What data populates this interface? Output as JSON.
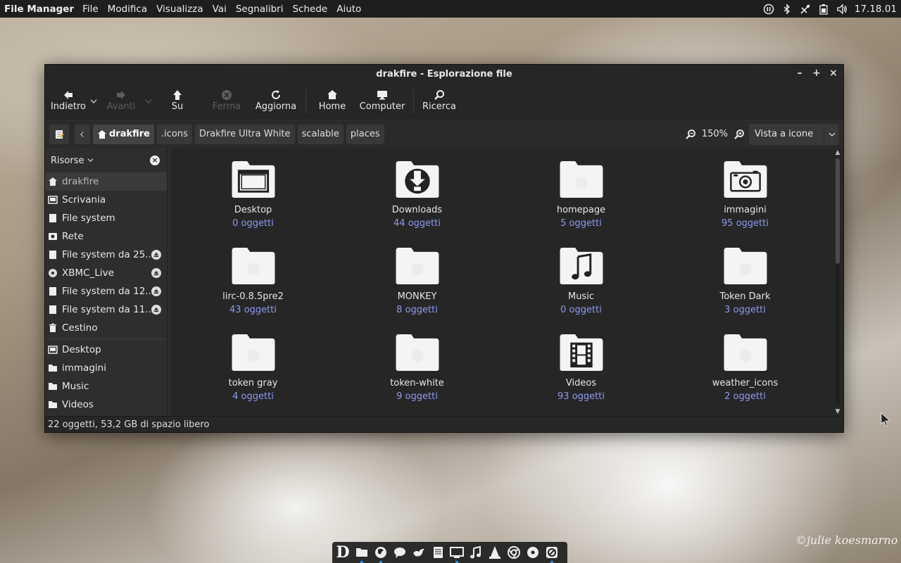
{
  "top_panel": {
    "app_name": "File Manager",
    "menus": [
      "File",
      "Modifica",
      "Visualizza",
      "Vai",
      "Segnalibri",
      "Schede",
      "Aiuto"
    ],
    "clock": "17.18.01"
  },
  "window": {
    "title": "drakfire - Esplorazione file",
    "controls": {
      "minimize": "–",
      "maximize": "+",
      "close": "×"
    }
  },
  "toolbar": {
    "back": "Indietro",
    "forward": "Avanti",
    "up": "Su",
    "stop": "Ferma",
    "reload": "Aggiorna",
    "home": "Home",
    "computer": "Computer",
    "search": "Ricerca"
  },
  "pathbar": {
    "crumbs": [
      "drakfire",
      ".icons",
      "Drakfire Ultra White",
      "scalable",
      "places"
    ],
    "zoom_level": "150%",
    "view_mode": "Vista a icone"
  },
  "sidebar": {
    "header": "Risorse",
    "places": [
      {
        "label": "drakfire",
        "icon": "home-icon"
      },
      {
        "label": "Scrivania",
        "icon": "desktop-icon"
      },
      {
        "label": "File system",
        "icon": "drive-icon"
      },
      {
        "label": "Rete",
        "icon": "network-icon"
      },
      {
        "label": "File system da 25...",
        "icon": "drive-icon",
        "eject": true
      },
      {
        "label": "XBMC_Live",
        "icon": "disc-icon",
        "eject": true
      },
      {
        "label": "File system da 12...",
        "icon": "drive-icon",
        "eject": true
      },
      {
        "label": "File system da 11...",
        "icon": "drive-icon",
        "eject": true
      },
      {
        "label": "Cestino",
        "icon": "trash-icon"
      }
    ],
    "bookmarks": [
      {
        "label": "Desktop",
        "icon": "desktop-icon"
      },
      {
        "label": "immagini",
        "icon": "folder-icon"
      },
      {
        "label": "Music",
        "icon": "folder-icon"
      },
      {
        "label": "Videos",
        "icon": "folder-icon"
      }
    ]
  },
  "files": [
    {
      "name": "Desktop",
      "count": "0 oggetti",
      "icon": "desktop-folder-icon"
    },
    {
      "name": "Downloads",
      "count": "44 oggetti",
      "icon": "downloads-folder-icon"
    },
    {
      "name": "homepage",
      "count": "5 oggetti",
      "icon": "folder-icon"
    },
    {
      "name": "immagini",
      "count": "95 oggetti",
      "icon": "camera-folder-icon"
    },
    {
      "name": "lirc-0.8.5pre2",
      "count": "43 oggetti",
      "icon": "folder-icon"
    },
    {
      "name": "MONKEY",
      "count": "8 oggetti",
      "icon": "folder-icon"
    },
    {
      "name": "Music",
      "count": "0 oggetti",
      "icon": "music-folder-icon"
    },
    {
      "name": "Token Dark",
      "count": "3 oggetti",
      "icon": "folder-icon"
    },
    {
      "name": "token gray",
      "count": "4 oggetti",
      "icon": "folder-icon"
    },
    {
      "name": "token-white",
      "count": "9 oggetti",
      "icon": "folder-icon"
    },
    {
      "name": "Videos",
      "count": "93 oggetti",
      "icon": "video-folder-icon"
    },
    {
      "name": "weather_icons",
      "count": "2 oggetti",
      "icon": "folder-icon"
    }
  ],
  "statusbar": "22 oggetti, 53,2 GB di spazio libero",
  "dock": {
    "launcher_letter": "D",
    "items": [
      "folder-icon",
      "firefox-icon",
      "chat-icon",
      "bird-icon",
      "notes-icon",
      "monitor-icon",
      "music-icon",
      "vlc-icon",
      "chrome-icon",
      "disc-icon",
      "blocked-icon"
    ]
  },
  "watermark": "©julie koesmarno",
  "colors": {
    "panel_bg": "#1e1e1e",
    "window_bg": "#2b2b2b",
    "link_blue": "#8e9bf0",
    "dock_indicator": "#3b8ee8"
  }
}
